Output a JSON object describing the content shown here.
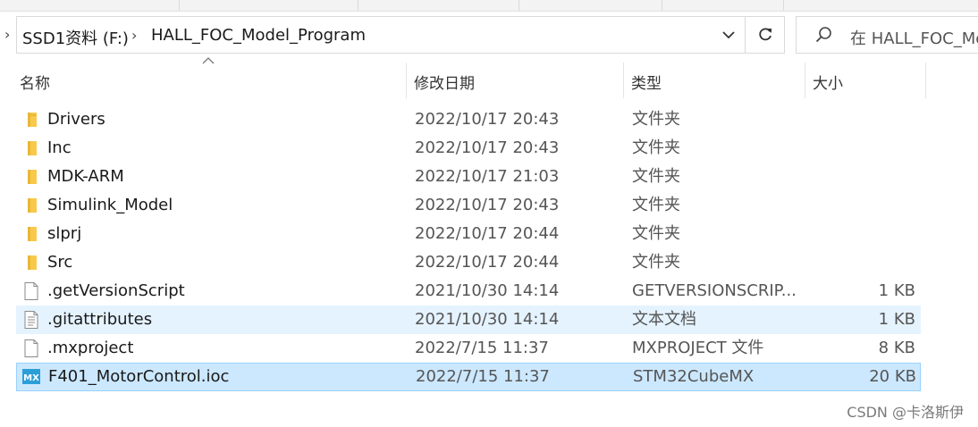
{
  "breadcrumb": {
    "items": [
      "SSD1资料 (F:)",
      "HALL_FOC_Model_Program"
    ]
  },
  "search": {
    "placeholder": "在 HALL_FOC_Model_Program 中搜索"
  },
  "columns": {
    "name": "名称",
    "date": "修改日期",
    "type": "类型",
    "size": "大小"
  },
  "files": [
    {
      "name": "Drivers",
      "date": "2022/10/17 20:43",
      "type": "文件夹",
      "size": "",
      "icon": "folder-icon"
    },
    {
      "name": "Inc",
      "date": "2022/10/17 20:43",
      "type": "文件夹",
      "size": "",
      "icon": "folder-icon"
    },
    {
      "name": "MDK-ARM",
      "date": "2022/10/17 21:03",
      "type": "文件夹",
      "size": "",
      "icon": "folder-icon"
    },
    {
      "name": "Simulink_Model",
      "date": "2022/10/17 20:43",
      "type": "文件夹",
      "size": "",
      "icon": "folder-icon"
    },
    {
      "name": "slprj",
      "date": "2022/10/17 20:44",
      "type": "文件夹",
      "size": "",
      "icon": "folder-icon"
    },
    {
      "name": "Src",
      "date": "2022/10/17 20:44",
      "type": "文件夹",
      "size": "",
      "icon": "folder-icon"
    },
    {
      "name": ".getVersionScript",
      "date": "2021/10/30 14:14",
      "type": "GETVERSIONSCRIP...",
      "size": "1 KB",
      "icon": "blank-file-icon"
    },
    {
      "name": ".gitattributes",
      "date": "2021/10/30 14:14",
      "type": "文本文档",
      "size": "1 KB",
      "icon": "text-file-icon"
    },
    {
      "name": ".mxproject",
      "date": "2022/7/15 11:37",
      "type": "MXPROJECT 文件",
      "size": "8 KB",
      "icon": "blank-file-icon"
    },
    {
      "name": "F401_MotorControl.ioc",
      "date": "2022/7/15 11:37",
      "type": "STM32CubeMX",
      "size": "20 KB",
      "icon": "mx-file-icon"
    }
  ],
  "watermark": "CSDN @卡洛斯伊",
  "colors": {
    "hover_row": "#e5f3ff",
    "selected_row": "#cce8ff",
    "selected_border": "#99d1ff",
    "folder": "#f8c94a",
    "mx_badge": "#2d9fd8"
  }
}
